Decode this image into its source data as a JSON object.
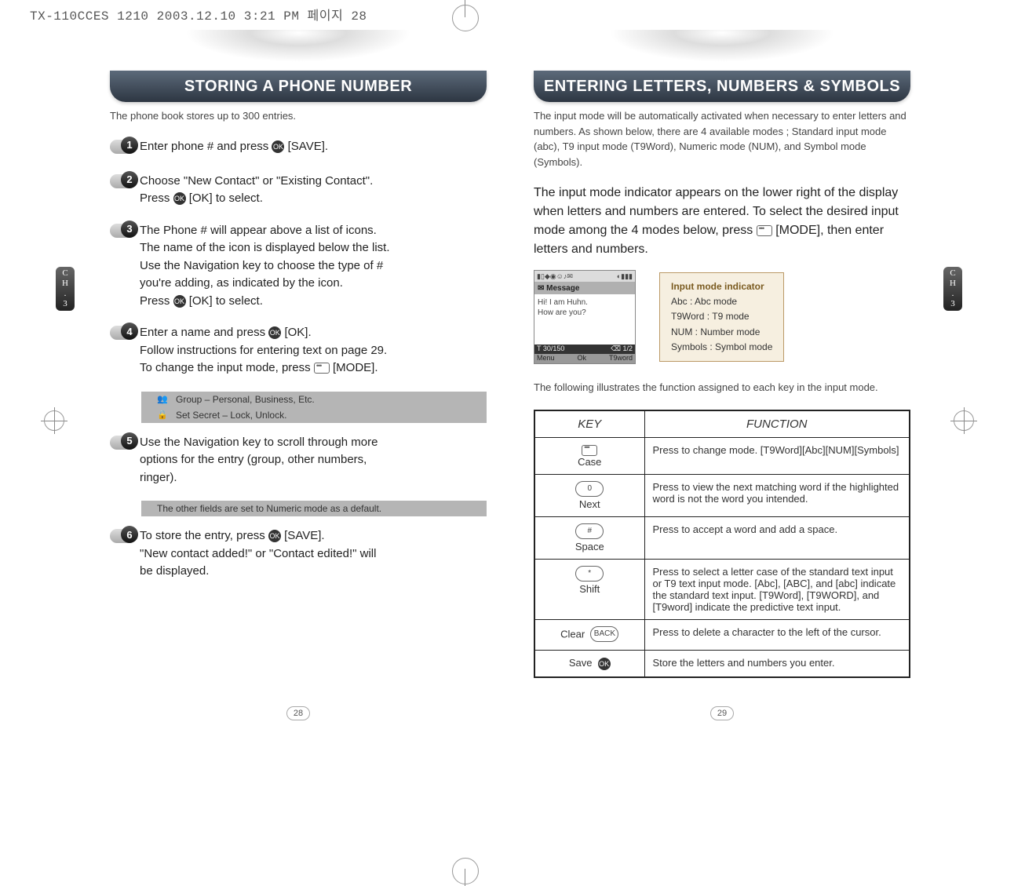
{
  "meta": {
    "header_line": "TX-110CCES 1210 2003.12.10 3:21 PM 페이지 28"
  },
  "left_page": {
    "title": "STORING A PHONE NUMBER",
    "intro": "The phone book stores up to 300 entries.",
    "side_tab": "CH.3",
    "page_number": "28",
    "steps": {
      "s1": {
        "num": "1",
        "text_a": "Enter phone # and press ",
        "text_b": " [SAVE]."
      },
      "s2": {
        "num": "2",
        "line1_a": "Choose \"New Contact\" or \"Existing Contact\".",
        "line2_a": "Press ",
        "line2_b": " [OK] to select."
      },
      "s3": {
        "num": "3",
        "l1": "The Phone # will appear above a list of icons.",
        "l2": "The name of the icon is displayed below the list.",
        "l3": "Use the Navigation key to choose the type of #",
        "l4": "you're adding, as indicated by the icon.",
        "l5_a": "Press ",
        "l5_b": " [OK] to select."
      },
      "s4": {
        "num": "4",
        "l1_a": "Enter a name and press ",
        "l1_b": " [OK].",
        "l2": "Follow instructions for entering text on page 29.",
        "l3_a": "To change the input mode, press ",
        "l3_b": " [MODE]."
      },
      "s5": {
        "num": "5",
        "l1": "Use the Navigation key to scroll through more",
        "l2": "options for the entry (group, other numbers,",
        "l3": "ringer)."
      },
      "s6": {
        "num": "6",
        "l1_a": "To store the entry, press ",
        "l1_b": " [SAVE].",
        "l2": "\"New contact added!\" or \"Contact edited!\" will",
        "l3": "be displayed."
      }
    },
    "notes": {
      "group": "Group – Personal, Business, Etc.",
      "secret": "Set Secret – Lock, Unlock.",
      "numeric_default": "The other fields are set to Numeric mode as a default."
    }
  },
  "right_page": {
    "title": "ENTERING LETTERS, NUMBERS & SYMBOLS",
    "intro": "The input mode will be automatically activated when necessary to enter letters and numbers. As shown below, there are 4 available modes ; Standard input mode (abc), T9 input mode (T9Word), Numeric mode (NUM), and Symbol mode (Symbols).",
    "body_para": "The input mode indicator appears on the lower right of the display when letters and numbers are entered. To select the desired input mode among the 4 modes below, press",
    "body_para_mode": "[MODE], then enter letters and numbers.",
    "side_tab": "CH.3",
    "page_number": "29",
    "phone": {
      "title_bar": "✉ Message",
      "msg_line1": "Hi! I am Huhn.",
      "msg_line2": "How are you?",
      "footer_a_left": "T 30/150",
      "footer_a_right": "⌫ 1/2",
      "footer_b_left": "Menu",
      "footer_b_mid": "Ok",
      "footer_b_right": "T9word"
    },
    "indicator": {
      "title": "Input mode indicator",
      "abc": "Abc : Abc mode",
      "t9": "T9Word : T9 mode",
      "num": "NUM : Number mode",
      "sym": "Symbols : Symbol mode"
    },
    "table_intro": "The following illustrates the function assigned to each key in the input mode.",
    "table": {
      "head_key": "KEY",
      "head_fn": "FUNCTION",
      "rows": [
        {
          "key_label": "Case",
          "fn": "Press to change mode. [T9Word][Abc][NUM][Symbols]"
        },
        {
          "key_label": "Next",
          "key_glyph": "0",
          "fn": "Press to view the next matching word if the highlighted word is not the word you intended."
        },
        {
          "key_label": "Space",
          "key_glyph": "#",
          "fn": "Press to accept a word and add a space."
        },
        {
          "key_label": "Shift",
          "key_glyph": "*",
          "fn": "Press to select a letter case of the standard text input or T9  text input mode. [Abc], [ABC], and [abc] indicate the standard text input. [T9Word], [T9WORD], and [T9word] indicate the predictive text input."
        },
        {
          "key_label": "Clear",
          "key_glyph": "BACK",
          "fn": "Press to delete a character to the left of the cursor."
        },
        {
          "key_label": "Save",
          "key_glyph": "OK",
          "fn": "Store the letters and numbers you enter."
        }
      ]
    }
  }
}
